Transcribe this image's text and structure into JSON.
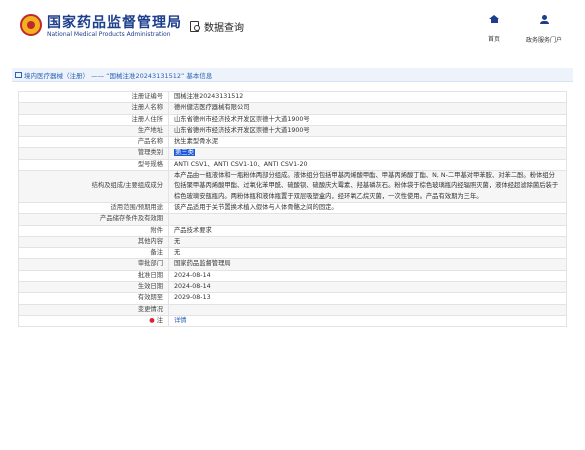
{
  "header": {
    "brand_cn": "国家药品监督管理局",
    "brand_en": "National Medical Products Administration",
    "search_label": "数据查询",
    "nav_home": "首页",
    "nav_portal": "政务服务门户"
  },
  "breadcrumb": "境内医疗器械（注册） —— “国械注准20243131512” 基本信息",
  "rows": [
    {
      "label": "注册证编号",
      "value": "国械注准20243131512"
    },
    {
      "label": "注册人名称",
      "value": "德州健洁医疗器械有限公司"
    },
    {
      "label": "注册人住所",
      "value": "山东省德州市经济技术开发区崇德十大道1900号"
    },
    {
      "label": "生产地址",
      "value": "山东省德州市经济技术开发区崇德十大道1900号"
    },
    {
      "label": "产品名称",
      "value": "抗生素型骨水泥"
    },
    {
      "label": "管理类别",
      "value": "第三类"
    },
    {
      "label": "型号规格",
      "value": "ANTI CSV1、ANTI CSV1-10、ANTI CSV1-20"
    },
    {
      "label": "结构及组成/主要组成成分",
      "value": "本产品由一瓶液体和一瓶粉体两部分组成。液体组分包括甲基丙烯酸甲酯、甲基丙烯酸丁酯、N, N-二甲基对甲苯胺、对苯二酚。粉体组分包括聚甲基丙烯酸甲酯、过氧化苯甲酰、硫酸钡、硫酸庆大霉素、羟基磷灰石。粉体袋于棕色玻璃瓶内经辐照灭菌，液体经超滤除菌后装于棕色玻璃安瓿瓶内。两粉体瓶和液体瓶置于双层吸塑盒内，经环氧乙烷灭菌，一次性使用。产品有效期为三年。"
    },
    {
      "label": "适用范围/预期用途",
      "value": "该产品适用于关节置换术植入假体与人体骨骼之间的固定。"
    },
    {
      "label": "产品储存条件及有效期",
      "value": ""
    },
    {
      "label": "附件",
      "value": "产品技术要求"
    },
    {
      "label": "其他内容",
      "value": "无"
    },
    {
      "label": "备注",
      "value": "无"
    },
    {
      "label": "审批部门",
      "value": "国家药品监督管理局"
    },
    {
      "label": "批准日期",
      "value": "2024-08-14"
    },
    {
      "label": "生效日期",
      "value": "2024-08-14"
    },
    {
      "label": "有效期至",
      "value": "2029-08-13"
    },
    {
      "label": "变更情况",
      "value": ""
    },
    {
      "label": "注",
      "value": "详情"
    }
  ],
  "colors": {
    "brand": "#1d3e8c",
    "link": "#2a63b8",
    "highlight": "#1f5bd6"
  }
}
